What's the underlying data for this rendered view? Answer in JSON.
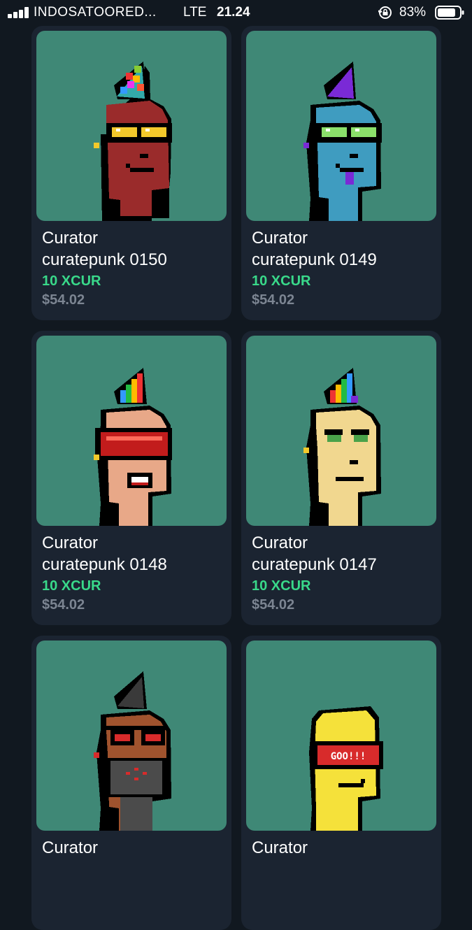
{
  "status_bar": {
    "carrier": "INDOSATOORED...",
    "network": "LTE",
    "time": "21.24",
    "battery_percent": "83%",
    "battery_level": 0.83
  },
  "cards": [
    {
      "title": "Curator",
      "name": "curatepunk 0150",
      "price_token": "10 XCUR",
      "price_usd": "$54.02",
      "image": "red-punk-rainbow-mohawk-yellow-shades-icon"
    },
    {
      "title": "Curator",
      "name": "curatepunk 0149",
      "price_token": "10 XCUR",
      "price_usd": "$54.02",
      "image": "blue-punk-purple-mohawk-green-shades-icon"
    },
    {
      "title": "Curator",
      "name": "curatepunk 0148",
      "price_token": "10 XCUR",
      "price_usd": "$54.02",
      "image": "tan-punk-rainbow-mohawk-red-visor-icon"
    },
    {
      "title": "Curator",
      "name": "curatepunk 0147",
      "price_token": "10 XCUR",
      "price_usd": "$54.02",
      "image": "yellow-punk-rainbow-mohawk-icon"
    },
    {
      "title": "Curator",
      "name": "",
      "price_token": "",
      "price_usd": "",
      "image": "brown-punk-black-mohawk-mask-icon"
    },
    {
      "title": "Curator",
      "name": "",
      "price_token": "",
      "price_usd": "",
      "image": "yellow-punk-goo-visor-icon",
      "visor_text": "GOO!!!"
    }
  ],
  "colors": {
    "background": "#111820",
    "card": "#1b2431",
    "art_background": "#3f8876",
    "token_green": "#39d98a",
    "usd_gray": "#7c8592"
  }
}
